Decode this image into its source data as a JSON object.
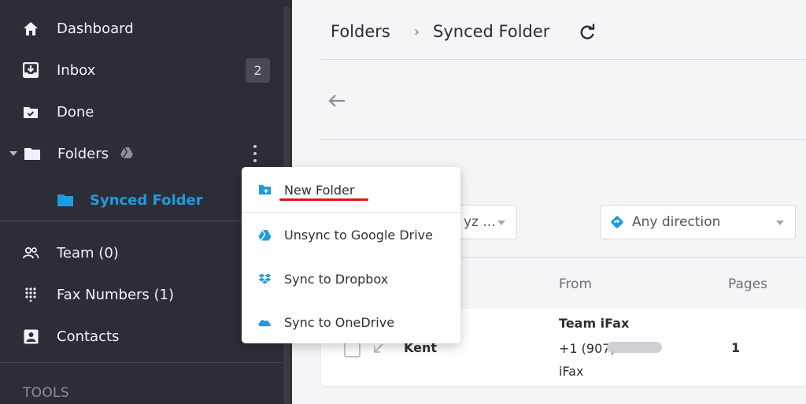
{
  "sidebar": {
    "items": [
      {
        "label": "Dashboard",
        "icon": "home-icon"
      },
      {
        "label": "Inbox",
        "icon": "inbox-icon",
        "badge": "2"
      },
      {
        "label": "Done",
        "icon": "done-folder-icon"
      },
      {
        "label": "Folders",
        "icon": "folder-icon"
      },
      {
        "label": "Synced Folder",
        "icon": "folder-icon"
      },
      {
        "label": "Team (0)",
        "icon": "team-icon"
      },
      {
        "label": "Fax Numbers (1)",
        "icon": "dialpad-icon"
      },
      {
        "label": "Contacts",
        "icon": "contact-icon"
      }
    ],
    "section_label": "TOOLS"
  },
  "breadcrumb": {
    "root": "Folders",
    "current": "Synced Folder"
  },
  "filters": {
    "first_partial": "yz ...",
    "direction": "Any direction"
  },
  "table": {
    "headers": [
      "From",
      "Pages"
    ],
    "row": {
      "name": "Kent",
      "from_title": "Team iFax",
      "from_number": "+1 (907)",
      "from_sub": "iFax",
      "pages": "1"
    }
  },
  "menu": {
    "items": [
      {
        "label": "New Folder",
        "icon": "new-folder-icon"
      },
      {
        "label": "Unsync to Google Drive",
        "icon": "google-drive-icon"
      },
      {
        "label": "Sync to Dropbox",
        "icon": "dropbox-icon"
      },
      {
        "label": "Sync to OneDrive",
        "icon": "onedrive-icon"
      }
    ]
  },
  "colors": {
    "sidebar_bg": "#2d2d37",
    "accent": "#1f9be0",
    "highlight_underline": "#e2141c"
  }
}
